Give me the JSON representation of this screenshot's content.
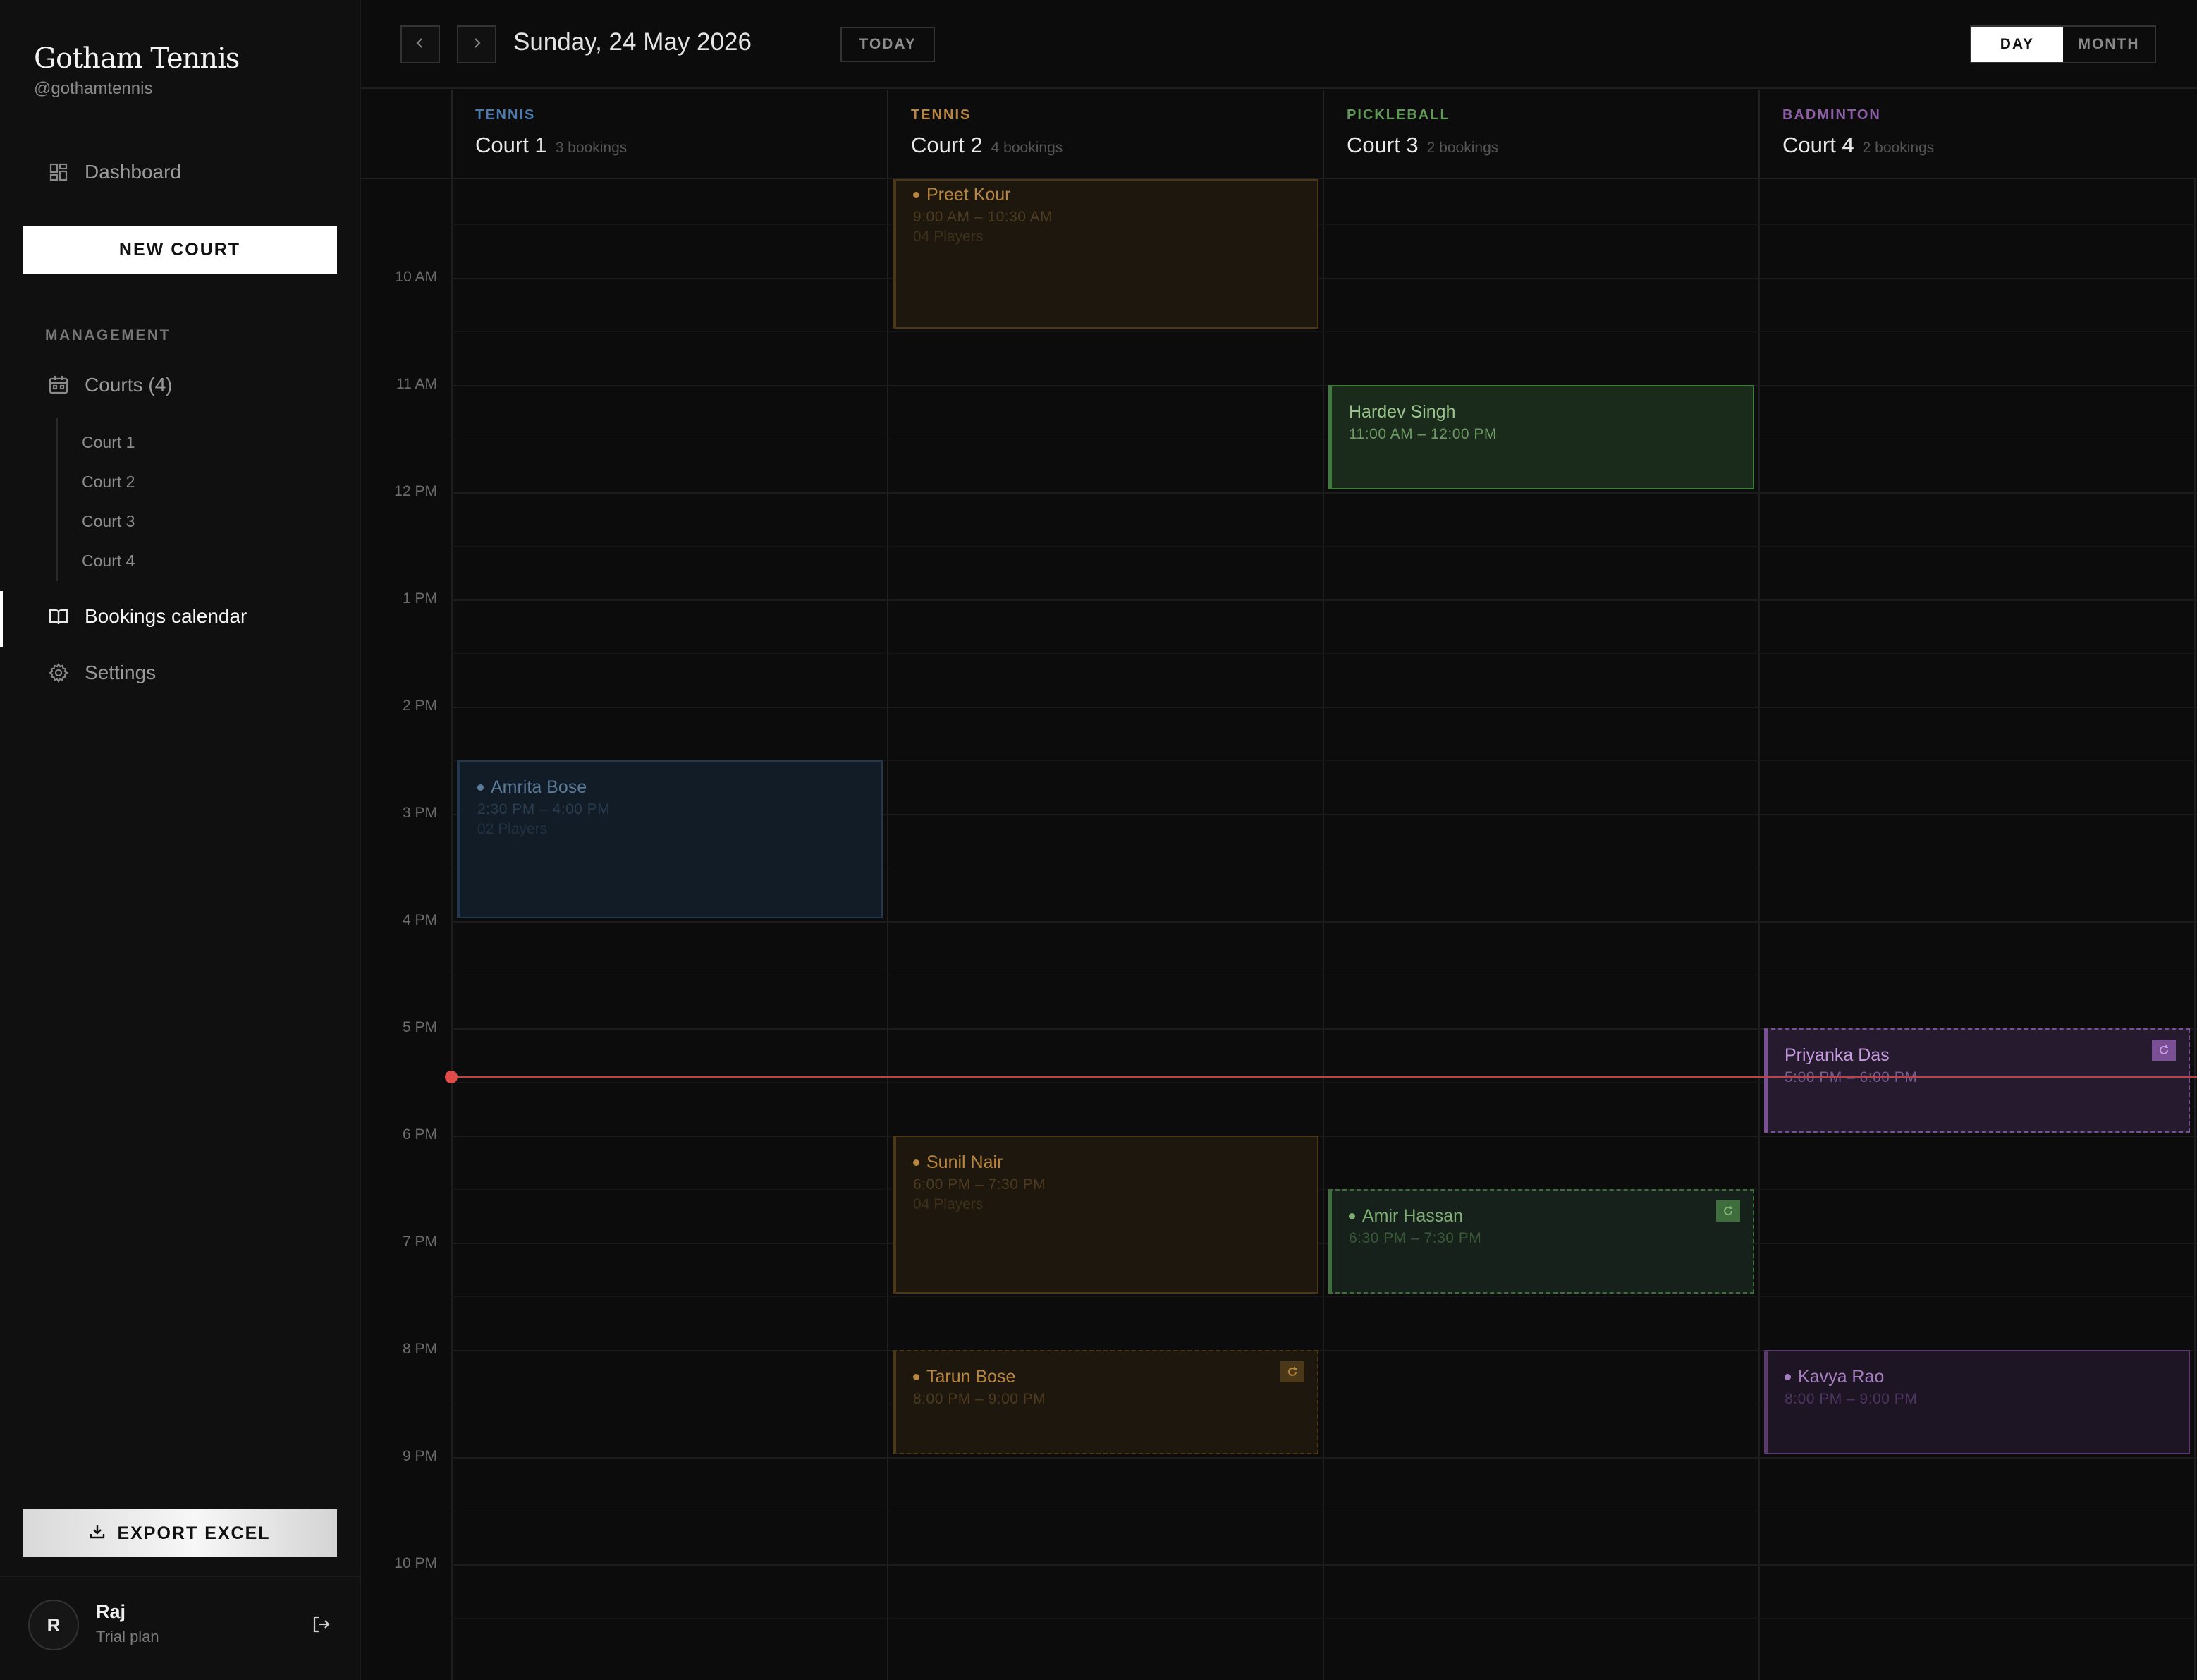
{
  "brand": {
    "name": "Gotham Tennis",
    "handle": "@gothamtennis"
  },
  "nav": {
    "dashboard": "Dashboard",
    "new_court": "NEW COURT",
    "section": "MANAGEMENT",
    "courts": "Courts (4)",
    "court_links": [
      "Court 1",
      "Court 2",
      "Court 3",
      "Court 4"
    ],
    "bookings": "Bookings calendar",
    "settings": "Settings",
    "active": "Bookings calendar"
  },
  "export": {
    "label": "EXPORT EXCEL"
  },
  "user": {
    "initial": "R",
    "name": "Raj",
    "plan": "Trial plan"
  },
  "header": {
    "date": "Sunday, 24 May 2026",
    "today": "TODAY",
    "views": {
      "day": "DAY",
      "month": "MONTH",
      "selected": "DAY"
    }
  },
  "hours": [
    "10 AM",
    "11 AM",
    "12 PM",
    "1 PM",
    "2 PM",
    "3 PM",
    "4 PM",
    "5 PM",
    "6 PM",
    "7 PM",
    "8 PM",
    "9 PM",
    "10 PM"
  ],
  "courts": [
    {
      "sport": "TENNIS",
      "name": "Court 1",
      "count": "3 bookings",
      "color": "#4a7bb0"
    },
    {
      "sport": "TENNIS",
      "name": "Court 2",
      "count": "4 bookings",
      "color": "#b8863e"
    },
    {
      "sport": "PICKLEBALL",
      "name": "Court 3",
      "count": "2 bookings",
      "color": "#5f9a55"
    },
    {
      "sport": "BADMINTON",
      "name": "Court 4",
      "count": "2 bookings",
      "color": "#8e5ea8"
    }
  ],
  "bookings": [
    {
      "name": "Preet Kour",
      "time": "9:00 AM – 10:30 AM",
      "players": "04 Players",
      "recurring": false
    },
    {
      "name": "Hardev Singh",
      "time": "11:00 AM – 12:00 PM",
      "players": "",
      "recurring": false
    },
    {
      "name": "Amrita Bose",
      "time": "2:30 PM – 4:00 PM",
      "players": "02 Players",
      "recurring": false
    },
    {
      "name": "Priyanka Das",
      "time": "5:00 PM – 6:00 PM",
      "players": "",
      "recurring": true
    },
    {
      "name": "Sunil Nair",
      "time": "6:00 PM – 7:30 PM",
      "players": "04 Players",
      "recurring": false
    },
    {
      "name": "Amir Hassan",
      "time": "6:30 PM – 7:30 PM",
      "players": "",
      "recurring": true
    },
    {
      "name": "Tarun Bose",
      "time": "8:00 PM – 9:00 PM",
      "players": "",
      "recurring": true
    },
    {
      "name": "Kavya Rao",
      "time": "8:00 PM – 9:00 PM",
      "players": "",
      "recurring": false
    }
  ],
  "icons": {
    "dashboard": "grid-icon",
    "courts": "calendar-icon",
    "bookings": "book-open-icon",
    "settings": "gear-icon",
    "export": "download-icon",
    "logout": "logout-icon",
    "prev": "chevron-left-icon",
    "next": "chevron-right-icon",
    "recurring": "repeat-icon"
  },
  "current_time_marker": true
}
